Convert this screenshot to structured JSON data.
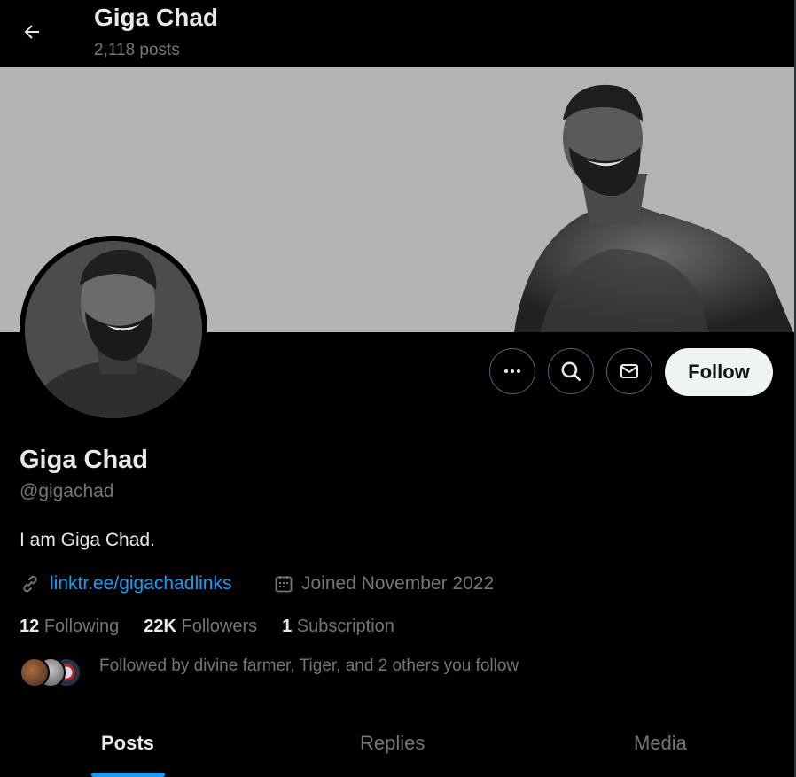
{
  "header": {
    "title": "Giga Chad",
    "posts_count": "2,118 posts"
  },
  "profile": {
    "name": "Giga Chad",
    "handle": "@gigachad",
    "bio": "I am Giga Chad.",
    "link": "linktr.ee/gigachadlinks",
    "joined": "Joined November 2022"
  },
  "actions": {
    "follow_label": "Follow"
  },
  "stats": {
    "following_count": "12",
    "following_label": "Following",
    "followers_count": "22K",
    "followers_label": "Followers",
    "subscription_count": "1",
    "subscription_label": "Subscription"
  },
  "followed_by": "Followed by divine farmer, Tiger, and 2 others you follow",
  "tabs": [
    {
      "label": "Posts",
      "active": true
    },
    {
      "label": "Replies",
      "active": false
    },
    {
      "label": "Media",
      "active": false
    }
  ],
  "colors": {
    "accent": "#1d9bf0",
    "background": "#000000",
    "banner": "#b4b4b4",
    "muted_text": "#71767b"
  }
}
